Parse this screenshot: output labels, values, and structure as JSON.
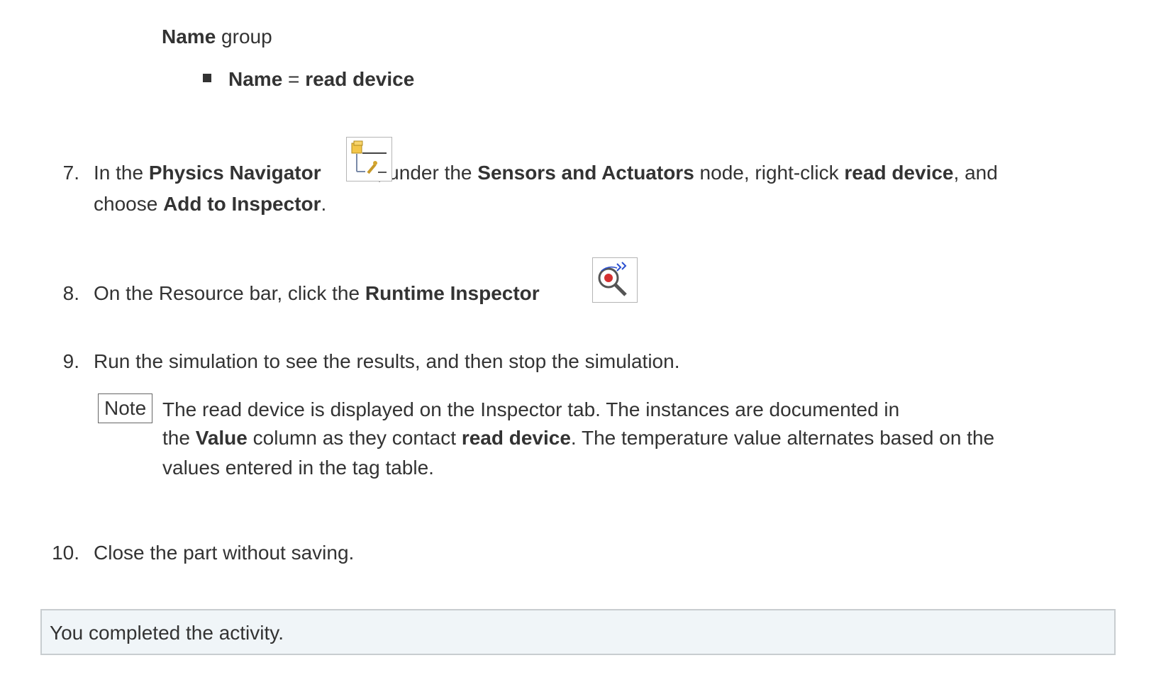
{
  "group_line": {
    "bold": "Name",
    "rest": " group"
  },
  "bullet_item": {
    "bold1": "Name",
    "eq": " = ",
    "bold2": "read device"
  },
  "steps": [
    {
      "number": "7.",
      "t1": "In the ",
      "b1": "Physics Navigator",
      "icon": "physics-navigator-icon",
      "t2": ", under the ",
      "b2": "Sensors and Actuators",
      "t3": " node, right-click ",
      "b3": "read device",
      "t4": ", and",
      "t5": "choose ",
      "b4": "Add to Inspector",
      "t6": "."
    },
    {
      "number": "8.",
      "t1": "On the Resource bar, click the ",
      "b1": "Runtime Inspector",
      "icon": "runtime-inspector-icon",
      "t2": "."
    },
    {
      "number": "9.",
      "t1": "Run the simulation to see the results, and then stop the simulation."
    },
    {
      "number": "10.",
      "t1": "Close the part without saving."
    }
  ],
  "note": {
    "label": "Note",
    "l1": "The read device is displayed on the Inspector tab. The instances are documented in",
    "l2a": "the ",
    "l2b": "Value",
    "l2c": " column as they contact ",
    "l2d": "read device",
    "l2e": ". The temperature value alternates based on the",
    "l3": "values entered in the tag table."
  },
  "completion": {
    "text": "You completed the activity.",
    "background": "#f0f5f8"
  }
}
